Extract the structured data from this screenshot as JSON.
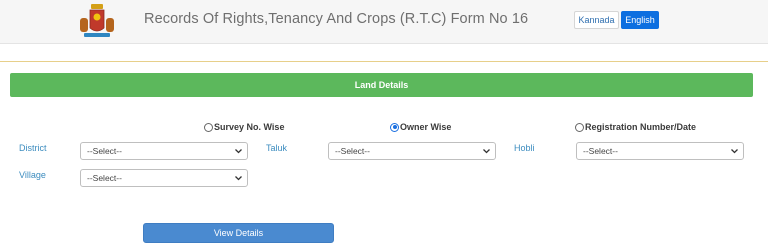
{
  "header": {
    "title": "Records Of Rights,Tenancy And Crops (R.T.C) Form No 16",
    "lang_kannada": "Kannada",
    "lang_english": "English",
    "emblem_icon": "state-emblem-icon"
  },
  "section": {
    "title": "Land Details"
  },
  "search_mode": {
    "options": [
      {
        "label": "Survey No. Wise",
        "checked": false
      },
      {
        "label": "Owner Wise",
        "checked": true
      },
      {
        "label": "Registration Number/Date",
        "checked": false
      }
    ]
  },
  "fields": {
    "district": {
      "label": "District",
      "value": "--Select--"
    },
    "taluk": {
      "label": "Taluk",
      "value": "--Select--"
    },
    "hobli": {
      "label": "Hobli",
      "value": "--Select--"
    },
    "village": {
      "label": "Village",
      "value": "--Select--"
    }
  },
  "actions": {
    "view_details": "View Details"
  },
  "colors": {
    "section_bar": "#5cb85c",
    "primary_button": "#4a8ad0",
    "active_language": "#0d6fe0",
    "label_text": "#3c8cbf"
  }
}
